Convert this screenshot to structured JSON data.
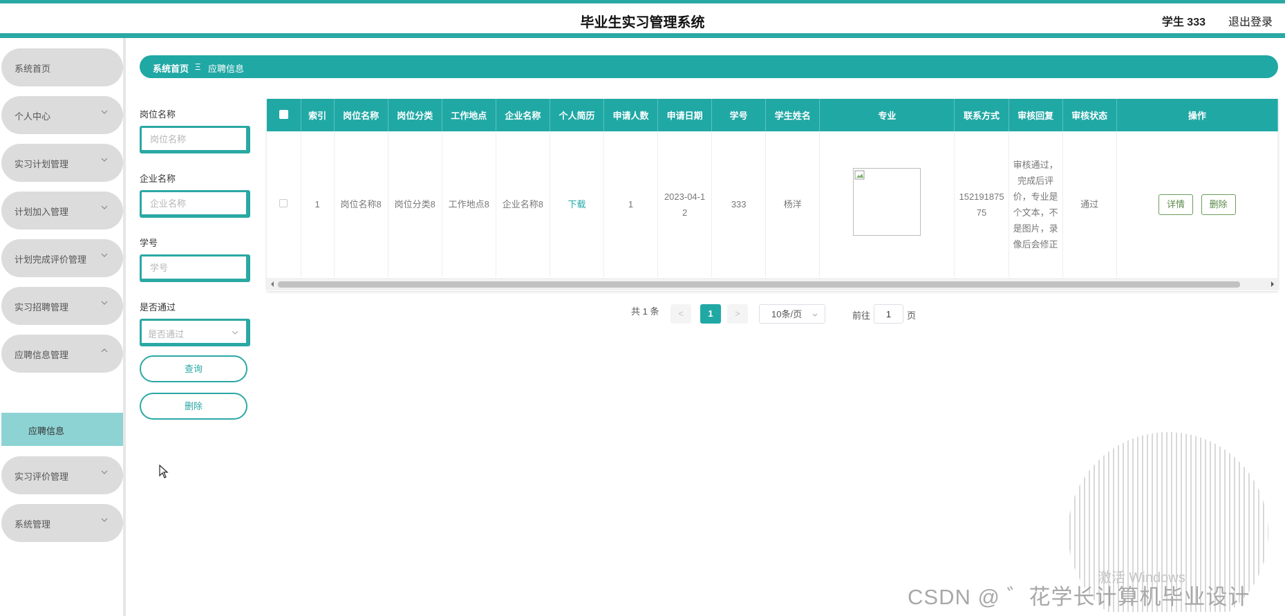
{
  "app": {
    "title": "毕业生实习管理系统",
    "user": "学生 333",
    "logout": "退出登录"
  },
  "sidebar": {
    "items": [
      {
        "label": "系统首页"
      },
      {
        "label": "个人中心"
      },
      {
        "label": "实习计划管理"
      },
      {
        "label": "计划加入管理"
      },
      {
        "label": "计划完成评价管理"
      },
      {
        "label": "实习招聘管理"
      },
      {
        "label": "应聘信息管理"
      },
      {
        "label": "实习评价管理"
      },
      {
        "label": "系统管理"
      }
    ],
    "active_sub": "应聘信息"
  },
  "breadcrumb": {
    "home": "系统首页",
    "sep": "Ξ",
    "current": "应聘信息"
  },
  "filters": {
    "post_label": "岗位名称",
    "post_placeholder": "岗位名称",
    "company_label": "企业名称",
    "company_placeholder": "企业名称",
    "sno_label": "学号",
    "sno_placeholder": "学号",
    "pass_label": "是否通过",
    "pass_placeholder": "是否通过",
    "query": "查询",
    "delete": "删除"
  },
  "table": {
    "headers": [
      "索引",
      "岗位名称",
      "岗位分类",
      "工作地点",
      "企业名称",
      "个人简历",
      "申请人数",
      "申请日期",
      "学号",
      "学生姓名",
      "专业",
      "联系方式",
      "审核回复",
      "审核状态",
      "操作"
    ],
    "row": {
      "index": "1",
      "post": "岗位名称8",
      "category": "岗位分类8",
      "location": "工作地点8",
      "company": "企业名称8",
      "resume": "下载",
      "applicants": "1",
      "date": "2023-04-12",
      "sno": "333",
      "name": "杨洋",
      "phone": "15219187575",
      "reply": "审核通过，完成后评价，专业是个文本，不是图片，录像后会修正",
      "status": "通过",
      "detail": "详情",
      "delete": "删除"
    }
  },
  "pagination": {
    "total": "共 1 条",
    "prev": "<",
    "page": "1",
    "next": ">",
    "size": "10条/页",
    "goto": "前往",
    "goto_value": "1",
    "unit": "页"
  },
  "watermark": {
    "activate": "激活 Windows",
    "csdn": "CSDN @ ゛花学长计算机毕业设计"
  },
  "colors": {
    "accent": "#20a8a5",
    "sidebar_bg": "#dcdcdc",
    "submenu_active": "#8ed3d4"
  }
}
